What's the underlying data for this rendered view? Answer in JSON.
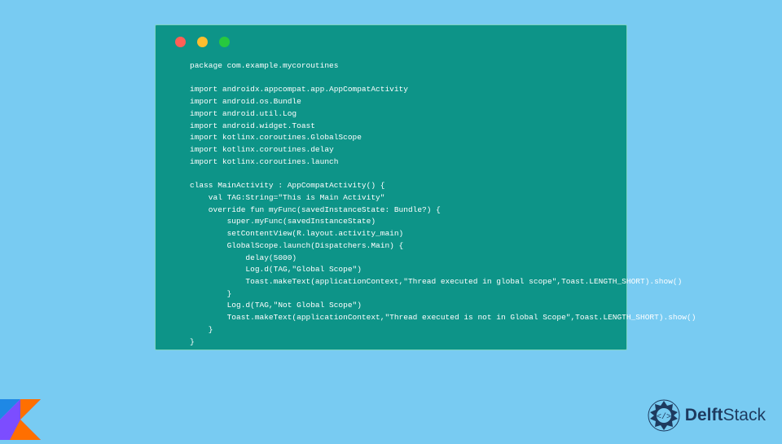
{
  "code": {
    "package": "package com.example.mycoroutines",
    "imports": [
      "import androidx.appcompat.app.AppCompatActivity",
      "import android.os.Bundle",
      "import android.util.Log",
      "import android.widget.Toast",
      "import kotlinx.coroutines.GlobalScope",
      "import kotlinx.coroutines.delay",
      "import kotlinx.coroutines.launch"
    ],
    "body": [
      "class MainActivity : AppCompatActivity() {",
      "    val TAG:String=\"This is Main Activity\"",
      "    override fun myFunc(savedInstanceState: Bundle?) {",
      "        super.myFunc(savedInstanceState)",
      "        setContentView(R.layout.activity_main)",
      "        GlobalScope.launch(Dispatchers.Main) {",
      "            delay(5000)",
      "            Log.d(TAG,\"Global Scope\")",
      "            Toast.makeText(applicationContext,\"Thread executed in global scope\",Toast.LENGTH_SHORT).show()",
      "        }",
      "        Log.d(TAG,\"Not Global Scope\")",
      "        Toast.makeText(applicationContext,\"Thread executed is not in Global Scope\",Toast.LENGTH_SHORT).show()",
      "    }",
      "}"
    ]
  },
  "brand": {
    "name_prefix": "Delft",
    "name_suffix": "Stack"
  },
  "colors": {
    "bg": "#78cbf2",
    "window": "#0d9488",
    "text": "#ffffff",
    "brand_text": "#1e3a5f"
  }
}
